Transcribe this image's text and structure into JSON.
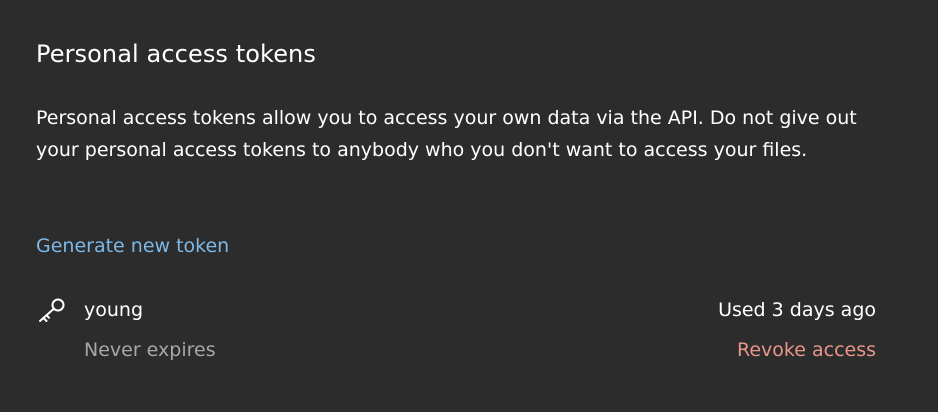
{
  "section": {
    "title": "Personal access tokens",
    "description": "Personal access tokens allow you to access your own data via the API. Do not give out your personal access tokens to anybody who you don't want to access your files.",
    "generate_label": "Generate new token"
  },
  "tokens": [
    {
      "icon": "key-icon",
      "name": "young",
      "expiry": "Never expires",
      "last_used": "Used 3 days ago",
      "revoke_label": "Revoke access"
    }
  ],
  "colors": {
    "background": "#2c2c2c",
    "link": "#7cb8e8",
    "danger": "#e8968a",
    "muted": "#a7a7a7"
  }
}
